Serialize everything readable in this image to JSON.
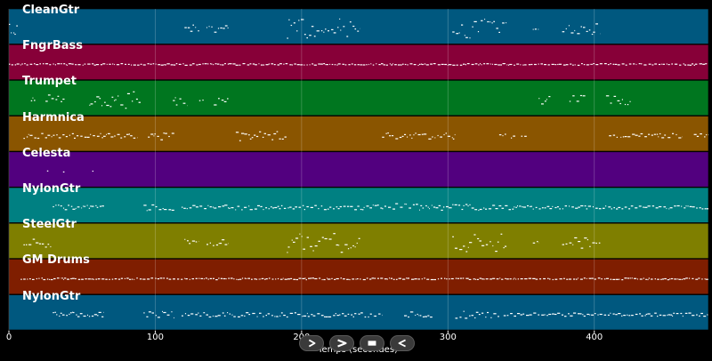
{
  "colors": {
    "background": "#000000",
    "note": "#ffffff",
    "grid": "#ffffff",
    "text": "#ffffff"
  },
  "tracks": [
    {
      "name": "CleanGtr",
      "color": "#00587f",
      "seed": 11,
      "note_ranges": [
        [
          0,
          6,
          15
        ],
        [
          120,
          130,
          6
        ],
        [
          135,
          150,
          5
        ],
        [
          190,
          240,
          14
        ],
        [
          303,
          340,
          22
        ],
        [
          358,
          362,
          3
        ],
        [
          378,
          404,
          7
        ]
      ]
    },
    {
      "name": "FngrBass",
      "color": "#870038",
      "seed": 23,
      "note_ranges": [
        [
          0,
          478,
          1
        ]
      ]
    },
    {
      "name": "Trumpet",
      "color": "#00761f",
      "seed": 37,
      "note_ranges": [
        [
          15,
          18,
          3
        ],
        [
          25,
          38,
          8
        ],
        [
          55,
          90,
          14
        ],
        [
          112,
          122,
          8
        ],
        [
          130,
          133,
          3
        ],
        [
          140,
          150,
          6
        ],
        [
          362,
          370,
          5
        ],
        [
          383,
          394,
          6
        ],
        [
          408,
          425,
          6
        ]
      ]
    },
    {
      "name": "Harmnica",
      "color": "#8a5500",
      "seed": 41,
      "note_ranges": [
        [
          10,
          88,
          3
        ],
        [
          95,
          113,
          5
        ],
        [
          155,
          190,
          6
        ],
        [
          255,
          305,
          4
        ],
        [
          335,
          340,
          3
        ],
        [
          343,
          346,
          3
        ],
        [
          350,
          355,
          2
        ],
        [
          410,
          416,
          3
        ],
        [
          418,
          460,
          3
        ],
        [
          468,
          478,
          3
        ]
      ]
    },
    {
      "name": "Celesta",
      "color": "#52007f",
      "seed": 53,
      "note_ranges": [
        [
          26,
          27,
          1
        ],
        [
          37,
          38,
          1
        ],
        [
          57,
          58,
          1
        ]
      ]
    },
    {
      "name": "NylonGtr",
      "color": "#008082",
      "seed": 67,
      "note_ranges": [
        [
          30,
          65,
          3
        ],
        [
          92,
          113,
          4
        ],
        [
          118,
          255,
          3
        ],
        [
          255,
          290,
          5
        ],
        [
          290,
          345,
          4
        ],
        [
          345,
          478,
          2
        ]
      ]
    },
    {
      "name": "SteelGtr",
      "color": "#7f7f00",
      "seed": 71,
      "note_ranges": [
        [
          10,
          30,
          5
        ],
        [
          120,
          130,
          5
        ],
        [
          135,
          150,
          5
        ],
        [
          190,
          240,
          13
        ],
        [
          303,
          340,
          21
        ],
        [
          358,
          362,
          3
        ],
        [
          378,
          404,
          7
        ]
      ]
    },
    {
      "name": "GM Drums",
      "color": "#7f1e00",
      "seed": 83,
      "note_ranges": [
        [
          8,
          478,
          1
        ]
      ]
    },
    {
      "name": "NylonGtr",
      "color": "#00587f",
      "seed": 97,
      "note_ranges": [
        [
          30,
          65,
          3
        ],
        [
          92,
          113,
          4
        ],
        [
          118,
          255,
          3
        ],
        [
          270,
          290,
          4
        ],
        [
          305,
          335,
          5
        ],
        [
          338,
          345,
          3
        ],
        [
          345,
          478,
          2
        ]
      ]
    }
  ],
  "x_axis": {
    "range": [
      0,
      478
    ],
    "ticks": [
      {
        "value": 0,
        "label": "0"
      },
      {
        "value": 100,
        "label": "100"
      },
      {
        "value": 200,
        "label": "200"
      },
      {
        "value": 300,
        "label": "300"
      },
      {
        "value": 400,
        "label": "400"
      }
    ],
    "label": "Temps (secondes)"
  },
  "transport": [
    {
      "name": "play-icon",
      "label": "play"
    },
    {
      "name": "skip-forward-icon",
      "label": "forward"
    },
    {
      "name": "stop-icon",
      "label": "stop"
    },
    {
      "name": "rewind-icon",
      "label": "back"
    }
  ]
}
